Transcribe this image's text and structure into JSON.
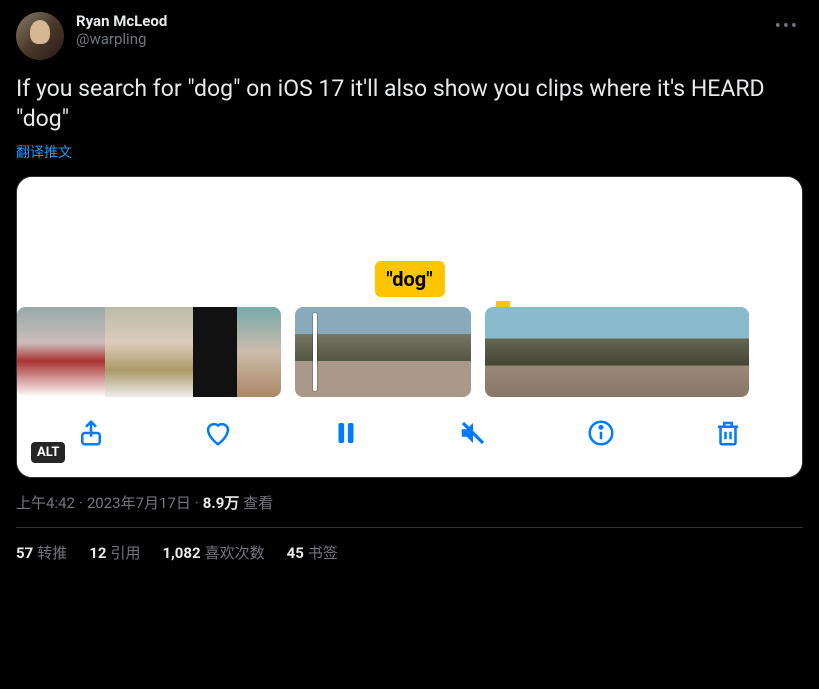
{
  "user": {
    "display_name": "Ryan McLeod",
    "handle": "@warpling"
  },
  "body_text": "If you search for \"dog\" on iOS 17 it'll also show you clips where it's HEARD \"dog\"",
  "translate_label": "翻译推文",
  "media": {
    "search_bubble": "\"dog\"",
    "alt_badge": "ALT",
    "toolbar": {
      "share": "share",
      "like": "like",
      "pause": "pause",
      "mute": "mute",
      "info": "info",
      "delete": "delete"
    }
  },
  "meta": {
    "time": "上午4:42",
    "date": "2023年7月17日",
    "views_number": "8.9万",
    "views_label": "查看"
  },
  "stats": {
    "retweets_num": "57",
    "retweets_label": "转推",
    "quotes_num": "12",
    "quotes_label": "引用",
    "likes_num": "1,082",
    "likes_label": "喜欢次数",
    "bookmarks_num": "45",
    "bookmarks_label": "书签"
  }
}
